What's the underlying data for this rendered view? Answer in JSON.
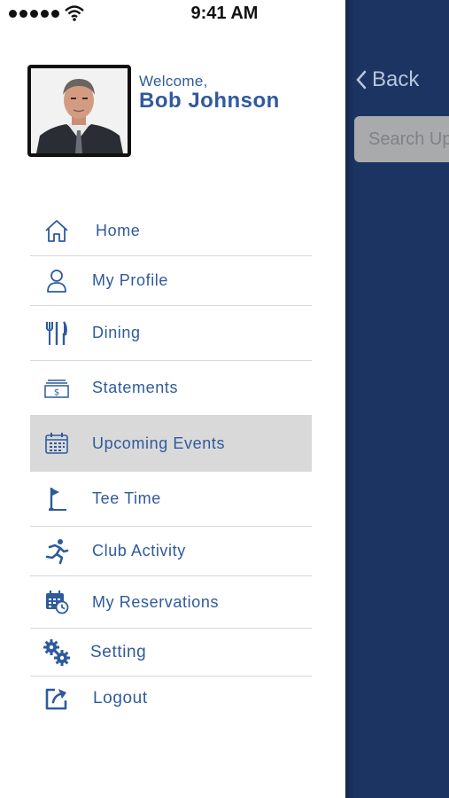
{
  "status_bar": {
    "time": "9:41 AM"
  },
  "profile": {
    "welcome": "Welcome,",
    "name": "Bob Johnson"
  },
  "menu": {
    "items": [
      {
        "label": "Home",
        "icon": "home-icon"
      },
      {
        "label": "My Profile",
        "icon": "user-icon"
      },
      {
        "label": "Dining",
        "icon": "dining-icon"
      },
      {
        "label": "Statements",
        "icon": "statement-icon"
      },
      {
        "label": "Upcoming Events",
        "icon": "calendar-icon",
        "active": true
      },
      {
        "label": "Tee Time",
        "icon": "golf-flag-icon"
      },
      {
        "label": "Club Activity",
        "icon": "running-icon"
      },
      {
        "label": "My Reservations",
        "icon": "calendar-clock-icon"
      },
      {
        "label": "Setting",
        "icon": "gears-icon"
      },
      {
        "label": "Logout",
        "icon": "logout-icon"
      }
    ]
  },
  "main": {
    "back_label": "Back",
    "search_placeholder": "Search Up"
  },
  "colors": {
    "accent": "#2f5a9c",
    "main_bg": "#1b3461",
    "active_row": "#d9d9d9"
  }
}
